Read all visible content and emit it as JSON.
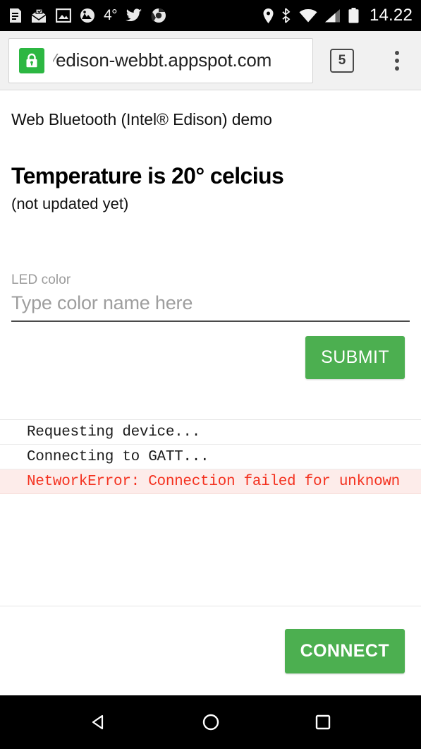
{
  "statusbar": {
    "notification_icons": [
      "news-icon",
      "mail-open-icon",
      "photo-icon",
      "weather-app-icon"
    ],
    "temperature": "4°",
    "social_icons": [
      "twitter-icon",
      "chrome-icon"
    ],
    "system_icons": [
      "location-icon",
      "bluetooth-icon",
      "wifi-icon",
      "cell-signal-icon",
      "battery-icon"
    ],
    "clock": "14.22"
  },
  "browser": {
    "security_icon": "lock-icon",
    "url_clipped_prefix": "⁄",
    "url": "edison-webbt.appspot.com",
    "tab_count": "5",
    "menu_icon": "more-vertical-icon"
  },
  "page": {
    "title": "Web Bluetooth (Intel® Edison) demo",
    "temperature_heading": "Temperature is 20° celcius",
    "temperature_status": "(not updated yet)",
    "form": {
      "led_label": "LED color",
      "led_value": "",
      "led_placeholder": "Type color name here",
      "submit_label": "SUBMIT"
    },
    "log": [
      {
        "text": "Requesting device...",
        "level": "info"
      },
      {
        "text": "Connecting to GATT...",
        "level": "info"
      },
      {
        "text": "NetworkError: Connection failed for unknown",
        "level": "error"
      },
      {
        "text": "",
        "level": "blank"
      }
    ],
    "connect_label": "CONNECT"
  },
  "navbar": {
    "back": "back-triangle-icon",
    "home": "home-circle-icon",
    "recents": "recents-square-icon"
  },
  "colors": {
    "accent_green": "#4caf50",
    "lock_green": "#2cb742",
    "error_red": "#f4311f",
    "error_bg": "#fdecea",
    "chrome_bg": "#f1f1f1"
  }
}
